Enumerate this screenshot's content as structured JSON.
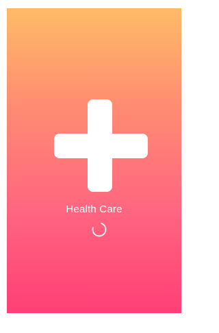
{
  "app": {
    "name": "Health Care"
  },
  "splash": {
    "logo_icon": "medical-cross-icon",
    "loading_indicator": "spinner-icon"
  },
  "colors": {
    "gradient_top": "#ffbb67",
    "gradient_mid": "#ff6680",
    "gradient_bottom": "#ff3f76",
    "foreground": "#ffffff"
  }
}
